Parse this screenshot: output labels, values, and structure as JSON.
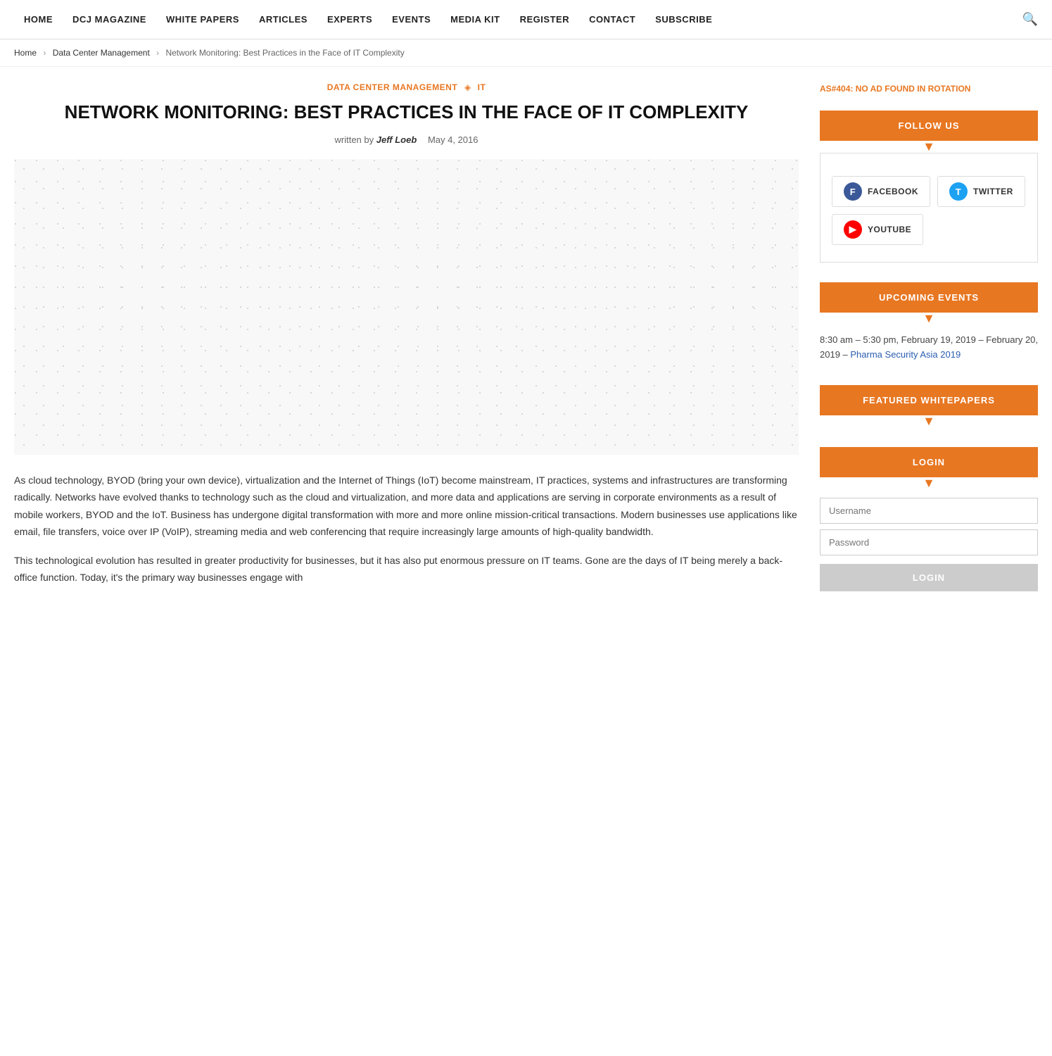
{
  "nav": {
    "items": [
      {
        "label": "HOME",
        "href": "#"
      },
      {
        "label": "DCJ MAGAZINE",
        "href": "#"
      },
      {
        "label": "WHITE PAPERS",
        "href": "#"
      },
      {
        "label": "ARTICLES",
        "href": "#"
      },
      {
        "label": "EXPERTS",
        "href": "#"
      },
      {
        "label": "EVENTS",
        "href": "#"
      },
      {
        "label": "MEDIA KIT",
        "href": "#"
      },
      {
        "label": "REGISTER",
        "href": "#"
      },
      {
        "label": "CONTACT",
        "href": "#"
      },
      {
        "label": "SUBSCRIBE",
        "href": "#"
      }
    ]
  },
  "breadcrumb": {
    "home": "Home",
    "category": "Data Center Management",
    "current": "Network Monitoring: Best Practices in the Face of IT Complexity"
  },
  "article": {
    "cat1": "DATA CENTER MANAGEMENT",
    "cat_sep": "◈",
    "cat2": "IT",
    "title": "NETWORK MONITORING: BEST PRACTICES IN THE FACE OF IT COMPLEXITY",
    "written_by_prefix": "written by ",
    "author": "Jeff Loeb",
    "date": "May 4, 2016",
    "body_p1": "As cloud technology, BYOD (bring your own device), virtualization and the Internet of Things (IoT) become mainstream, IT practices, systems and infrastructures are transforming radically. Networks have evolved thanks to technology such as the cloud and virtualization, and more data and applications are serving in corporate environments as a result of mobile workers, BYOD and the IoT. Business has undergone digital transformation with more and more online mission-critical transactions. Modern businesses use applications like email, file transfers, voice over IP (VoIP), streaming media and web conferencing that require increasingly large amounts of high-quality bandwidth.",
    "body_p2": "This technological evolution has resulted in greater productivity for businesses, but it has also put enormous pressure on IT teams. Gone are the days of IT being merely a back-office function. Today, it's the primary way businesses engage with"
  },
  "sidebar": {
    "ad_text": "AS#404: NO AD FOUND IN ROTATION",
    "follow_us": {
      "header": "FOLLOW US",
      "facebook_label": "FACEBOOK",
      "twitter_label": "TWITTER",
      "youtube_label": "YOUTUBE"
    },
    "upcoming_events": {
      "header": "UPCOMING EVENTS",
      "event_time": "8:30 am – 5:30 pm, February 19, 2019 – February 20, 2019 –",
      "event_link": "Pharma Security Asia 2019"
    },
    "featured_whitepapers": {
      "header": "FEATURED WHITEPAPERS"
    },
    "login": {
      "header": "LOGIN",
      "username_placeholder": "Username",
      "password_placeholder": "Password",
      "button_label": "LOGIN"
    }
  }
}
